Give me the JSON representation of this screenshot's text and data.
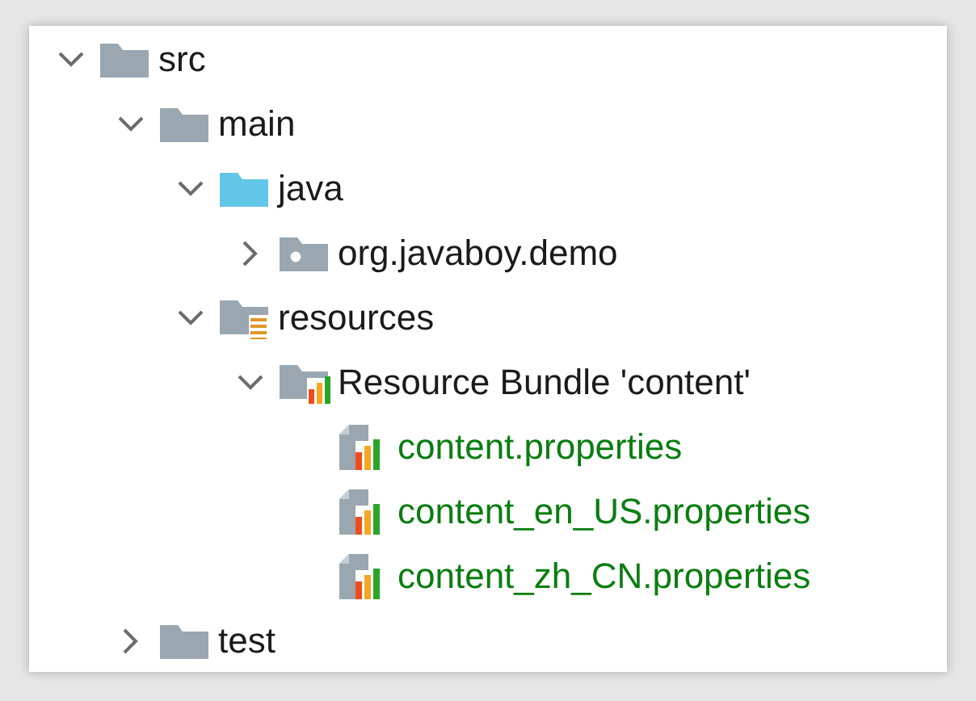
{
  "tree": [
    {
      "label": "src",
      "kind": "folder",
      "expanded": true,
      "children": [
        {
          "label": "main",
          "kind": "folder",
          "expanded": true,
          "children": [
            {
              "label": "java",
              "kind": "source-folder",
              "expanded": true,
              "children": [
                {
                  "label": "org.javaboy.demo",
                  "kind": "package",
                  "expanded": false
                }
              ]
            },
            {
              "label": "resources",
              "kind": "resource-folder",
              "expanded": true,
              "children": [
                {
                  "label": "Resource Bundle 'content'",
                  "kind": "bundle",
                  "expanded": true,
                  "children": [
                    {
                      "label": "content.properties",
                      "kind": "properties"
                    },
                    {
                      "label": "content_en_US.properties",
                      "kind": "properties"
                    },
                    {
                      "label": "content_zh_CN.properties",
                      "kind": "properties"
                    }
                  ]
                }
              ]
            }
          ]
        },
        {
          "label": "test",
          "kind": "folder",
          "expanded": false
        }
      ]
    }
  ]
}
